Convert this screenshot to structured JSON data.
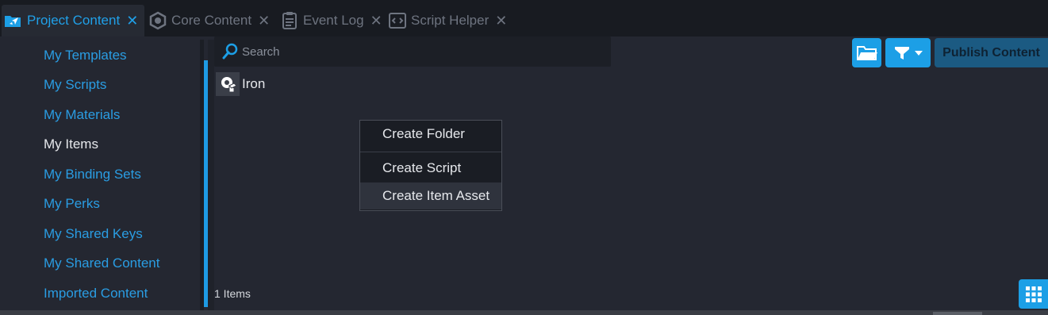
{
  "tabs": [
    {
      "label": "Project Content",
      "icon": "project-content-icon",
      "active": true
    },
    {
      "label": "Core Content",
      "icon": "core-content-icon",
      "active": false
    },
    {
      "label": "Event Log",
      "icon": "event-log-icon",
      "active": false
    },
    {
      "label": "Script Helper",
      "icon": "script-helper-icon",
      "active": false
    }
  ],
  "tab_close_glyph": "✕",
  "sidebar": {
    "items": [
      {
        "label": "My Templates"
      },
      {
        "label": "My Scripts"
      },
      {
        "label": "My Materials"
      },
      {
        "label": "My Items",
        "selected": true
      },
      {
        "label": "My Binding Sets"
      },
      {
        "label": "My Perks"
      },
      {
        "label": "My Shared Keys"
      },
      {
        "label": "My Shared Content"
      },
      {
        "label": "Imported Content"
      }
    ]
  },
  "search": {
    "placeholder": "Search",
    "value": ""
  },
  "toolbar": {
    "folder_icon": "folder-icon",
    "filter_icon": "filter-icon",
    "publish_label": "Publish Content"
  },
  "items": [
    {
      "label": "Iron",
      "icon": "item-asset-icon"
    }
  ],
  "context_menu": {
    "items": [
      {
        "label": "Create Folder"
      },
      {
        "label": "Create Script"
      },
      {
        "label": "Create Item Asset",
        "highlighted": true
      }
    ]
  },
  "footer": {
    "count_text": "1 Items"
  },
  "colors": {
    "accent": "#1c9fe6",
    "sidebar_link": "#2a9de3",
    "background": "#242731",
    "tabbar": "#181b21"
  }
}
